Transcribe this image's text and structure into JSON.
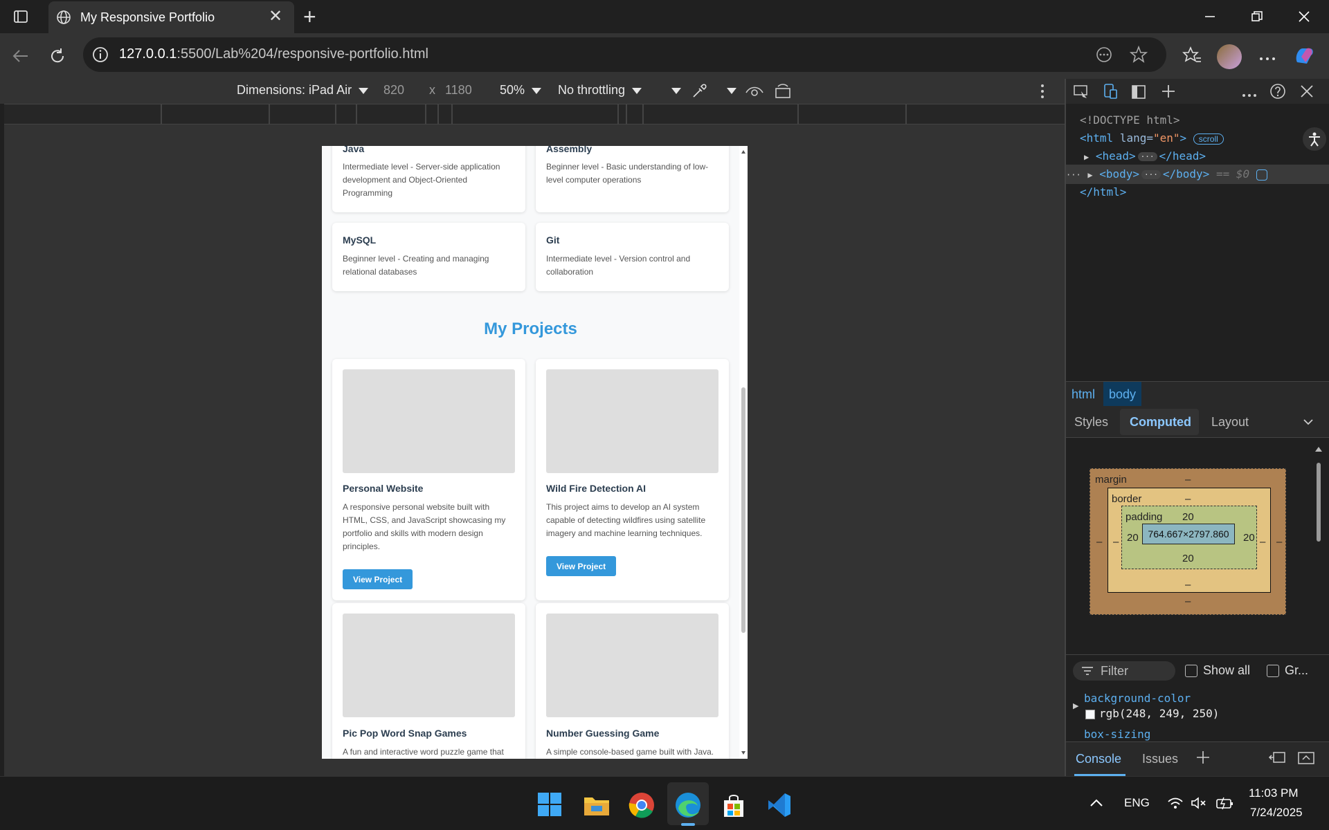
{
  "browser": {
    "tab_title": "My Responsive Portfolio",
    "url_host": "127.0.0.1",
    "url_rest": ":5500/Lab%204/responsive-portfolio.html",
    "new_tab_symbol": "+",
    "close_tab_symbol": "✕"
  },
  "device_toolbar": {
    "dimensions_label": "Dimensions: iPad Air",
    "width": "820",
    "times": "x",
    "height": "1180",
    "zoom": "50%",
    "throttling": "No throttling"
  },
  "page": {
    "skills": [
      {
        "title": "Java",
        "desc": "Intermediate level - Server-side application development and Object-Oriented Programming"
      },
      {
        "title": "Assembly",
        "desc": "Beginner level - Basic understanding of low-level computer operations"
      },
      {
        "title": "MySQL",
        "desc": "Beginner level - Creating and managing relational databases"
      },
      {
        "title": "Git",
        "desc": "Intermediate level - Version control and collaboration"
      }
    ],
    "projects_heading": "My Projects",
    "projects": [
      {
        "title": "Personal Website",
        "desc": "A responsive personal website built with HTML, CSS, and JavaScript showcasing my portfolio and skills with modern design principles.",
        "button": "View Project"
      },
      {
        "title": "Wild Fire Detection AI",
        "desc": "This project aims to develop an AI system capable of detecting wildfires using satellite imagery and machine learning techniques.",
        "button": "View Project"
      },
      {
        "title": "Pic Pop Word Snap Games",
        "desc": "A fun and interactive word puzzle game that"
      },
      {
        "title": "Number Guessing Game",
        "desc": "A simple console-based game built with Java."
      }
    ]
  },
  "devtools": {
    "doctype": "<!DOCTYPE html>",
    "html_open_tag": "<html",
    "lang_attr": " lang=",
    "lang_val": "\"en\"",
    "gt": ">",
    "scroll_badge": "scroll",
    "head_open": "<head>",
    "head_close": "</head>",
    "body_open": "<body>",
    "body_close": "</body>",
    "ellipsis": "···",
    "eq_dollar": "== $0",
    "html_close": "</html>",
    "breadcrumb": [
      "html",
      "body"
    ],
    "style_tabs": [
      "Styles",
      "Computed",
      "Layout"
    ],
    "box_model": {
      "margin_label": "margin",
      "border_label": "border",
      "padding_label": "padding",
      "dash": "–",
      "padding_top": "20",
      "padding_left": "20",
      "padding_right": "20",
      "padding_bottom": "20",
      "content_size": "764.667×2797.860"
    },
    "filter_placeholder": "Filter",
    "show_all": "Show all",
    "group": "Gr...",
    "computed_props": [
      {
        "name": "background-color",
        "value": "rgb(248, 249, 250)"
      },
      {
        "name": "box-sizing",
        "value": ""
      }
    ],
    "drawer_tabs": [
      "Console",
      "Issues"
    ]
  },
  "taskbar": {
    "language": "ENG",
    "time": "11:03 PM",
    "date": "7/24/2025"
  },
  "colors": {
    "accent": "#3498db",
    "heading": "#2c3e50",
    "page_bg": "#f8f9fa",
    "devtools_tag": "#5db0f0"
  }
}
